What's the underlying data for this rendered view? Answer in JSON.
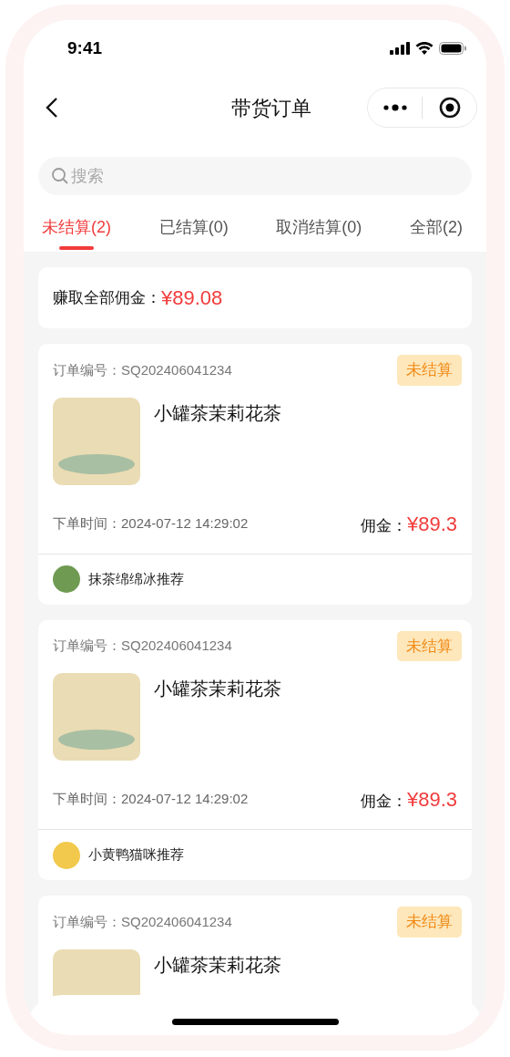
{
  "status_bar": {
    "time": "9:41"
  },
  "nav": {
    "title": "带货订单"
  },
  "search": {
    "placeholder": "搜索"
  },
  "tabs": [
    {
      "label": "未结算(2)",
      "selected": true
    },
    {
      "label": "已结算(0)",
      "selected": false
    },
    {
      "label": "取消结算(0)",
      "selected": false
    },
    {
      "label": "全部(2)",
      "selected": false
    }
  ],
  "summary": {
    "label": "赚取全部佣金：",
    "amount": "¥89.08"
  },
  "orders": [
    {
      "order_label": "订单编号：",
      "order_no": "SQ202406041234",
      "status": "未结算",
      "title": "小罐茶茉莉花茶",
      "time_label": "下单时间：",
      "time": "2024-07-12 14:29:02",
      "commission_label": "佣金：",
      "commission": "¥89.3",
      "recommender": {
        "name": "抹茶绵绵冰推荐",
        "color": "#6f9a52"
      }
    },
    {
      "order_label": "订单编号：",
      "order_no": "SQ202406041234",
      "status": "未结算",
      "title": "小罐茶茉莉花茶",
      "time_label": "下单时间：",
      "time": "2024-07-12 14:29:02",
      "commission_label": "佣金：",
      "commission": "¥89.3",
      "recommender": {
        "name": "小黄鸭猫咪推荐",
        "color": "#f2c94c"
      }
    },
    {
      "order_label": "订单编号：",
      "order_no": "SQ202406041234",
      "status": "未结算",
      "title": "小罐茶茉莉花茶"
    }
  ]
}
